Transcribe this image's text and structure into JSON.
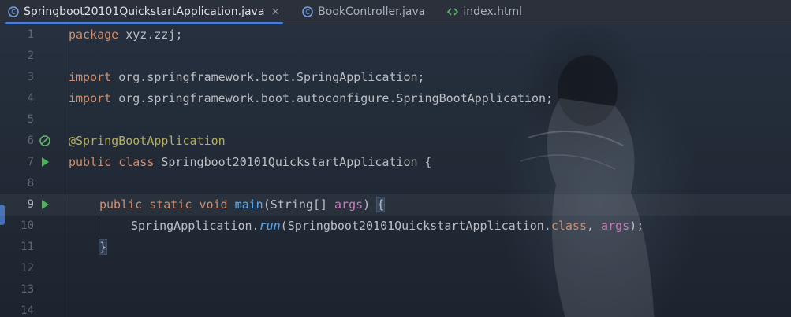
{
  "tabs": [
    {
      "label": "Springboot20101QuickstartApplication.java",
      "icon": "java-class-icon",
      "active": true,
      "close": "×"
    },
    {
      "label": "BookController.java",
      "icon": "java-class-icon",
      "active": false
    },
    {
      "label": "index.html",
      "icon": "html-file-icon",
      "active": false
    }
  ],
  "editor": {
    "line_numbers": [
      "1",
      "2",
      "3",
      "4",
      "5",
      "6",
      "7",
      "8",
      "9",
      "10",
      "11",
      "12",
      "13",
      "14"
    ],
    "lines": {
      "l1": [
        "package",
        "xyz.zzj;"
      ],
      "l3": [
        "import",
        "org.springframework.boot.SpringApplication;"
      ],
      "l4": [
        "import",
        "org.springframework.boot.autoconfigure.SpringBootApplication;"
      ],
      "l6": [
        "@SpringBootApplication"
      ],
      "l7": [
        "public",
        "class",
        "Springboot20101QuickstartApplication",
        "{"
      ],
      "l9": [
        "public",
        "static",
        "void",
        "main",
        "(",
        "String",
        "[]",
        "args",
        ")",
        "{"
      ],
      "l10": [
        "SpringApplication",
        ".",
        "run",
        "(",
        "Springboot20101QuickstartApplication",
        ".",
        "class",
        ",",
        "args",
        ");"
      ],
      "l11": [
        "}"
      ]
    },
    "current_line": "9",
    "colors": {
      "keyword": "#cf8e6d",
      "annotation": "#b3ae60",
      "method": "#56a8f5",
      "param": "#c77dbb",
      "accent": "#4a7fd6",
      "run": "#4fb35a"
    }
  }
}
